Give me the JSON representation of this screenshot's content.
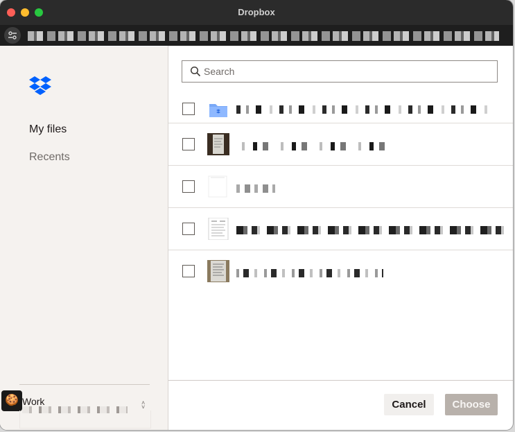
{
  "window": {
    "title": "Dropbox"
  },
  "sidebar": {
    "items": [
      {
        "label": "My files"
      },
      {
        "label": "Recents"
      }
    ],
    "account": {
      "name": "Work"
    }
  },
  "search": {
    "placeholder": "Search"
  },
  "files": [
    {
      "type": "folder",
      "thumbnail": "dropbox-folder-icon"
    },
    {
      "type": "image",
      "thumbnail": "receipt-photo"
    },
    {
      "type": "document",
      "thumbnail": "blank-page"
    },
    {
      "type": "document",
      "thumbnail": "document-page"
    },
    {
      "type": "image",
      "thumbnail": "receipt-photo"
    }
  ],
  "footer": {
    "cancel_label": "Cancel",
    "choose_label": "Choose"
  },
  "colors": {
    "brand_blue": "#0061fe",
    "sidebar_bg": "#f5f2ef",
    "choose_disabled": "#b8b1ab"
  }
}
